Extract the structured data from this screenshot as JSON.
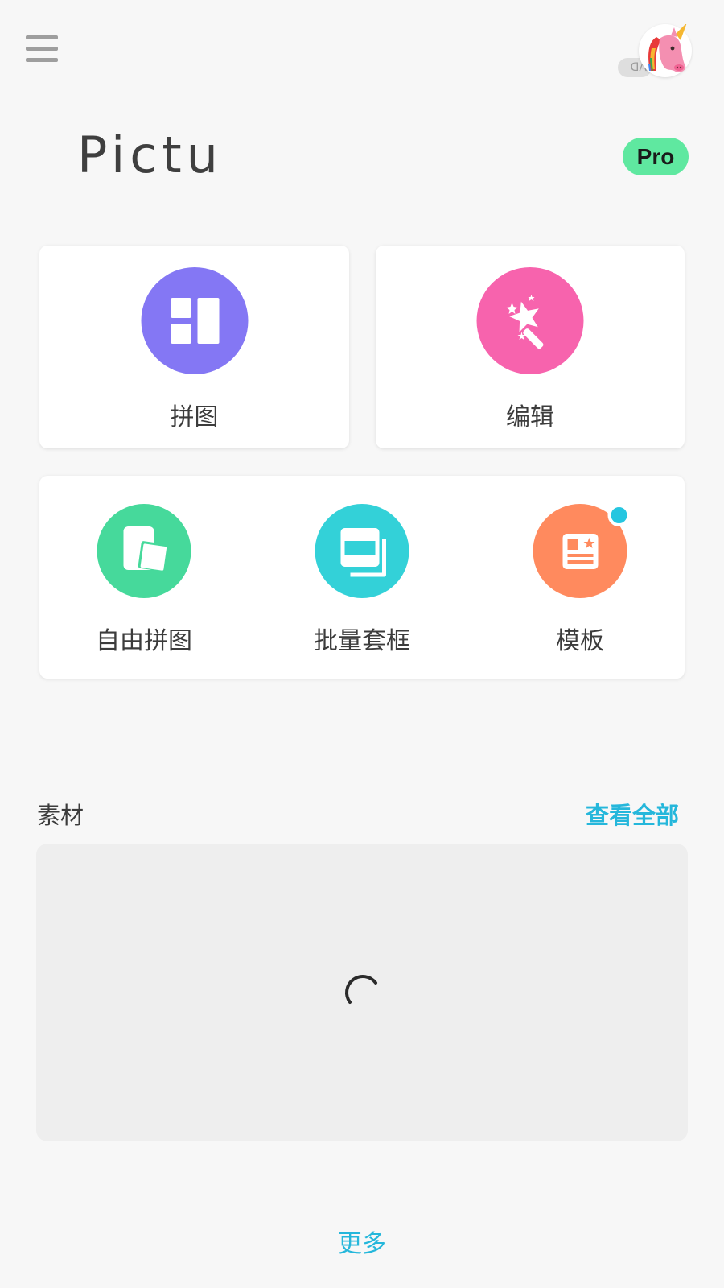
{
  "header": {
    "menu_icon": "hamburger-menu-icon",
    "ad_label": "AD",
    "ad_avatar_icon": "unicorn-icon"
  },
  "brand": {
    "logo_text": "Pictu",
    "pro_label": "Pro",
    "pro_color": "#5fe8a0"
  },
  "main_cards": [
    {
      "label": "拼图",
      "icon": "collage-layout-icon",
      "color": "#8477f4"
    },
    {
      "label": "编辑",
      "icon": "magic-wand-icon",
      "color": "#f763ad"
    }
  ],
  "tools": [
    {
      "label": "自由拼图",
      "icon": "free-collage-icon",
      "color": "#46d99b"
    },
    {
      "label": "批量套框",
      "icon": "batch-frame-icon",
      "color": "#33d1d8"
    },
    {
      "label": "模板",
      "icon": "template-icon",
      "color": "#ff8a5e",
      "has_new_dot": true
    }
  ],
  "materials": {
    "title": "素材",
    "view_all_label": "查看全部",
    "loading_icon": "loading-spinner-icon"
  },
  "footer": {
    "more_label": "更多"
  },
  "colors": {
    "background": "#f7f7f7",
    "accent": "#25b7db",
    "new_dot": "#26c6e0"
  }
}
